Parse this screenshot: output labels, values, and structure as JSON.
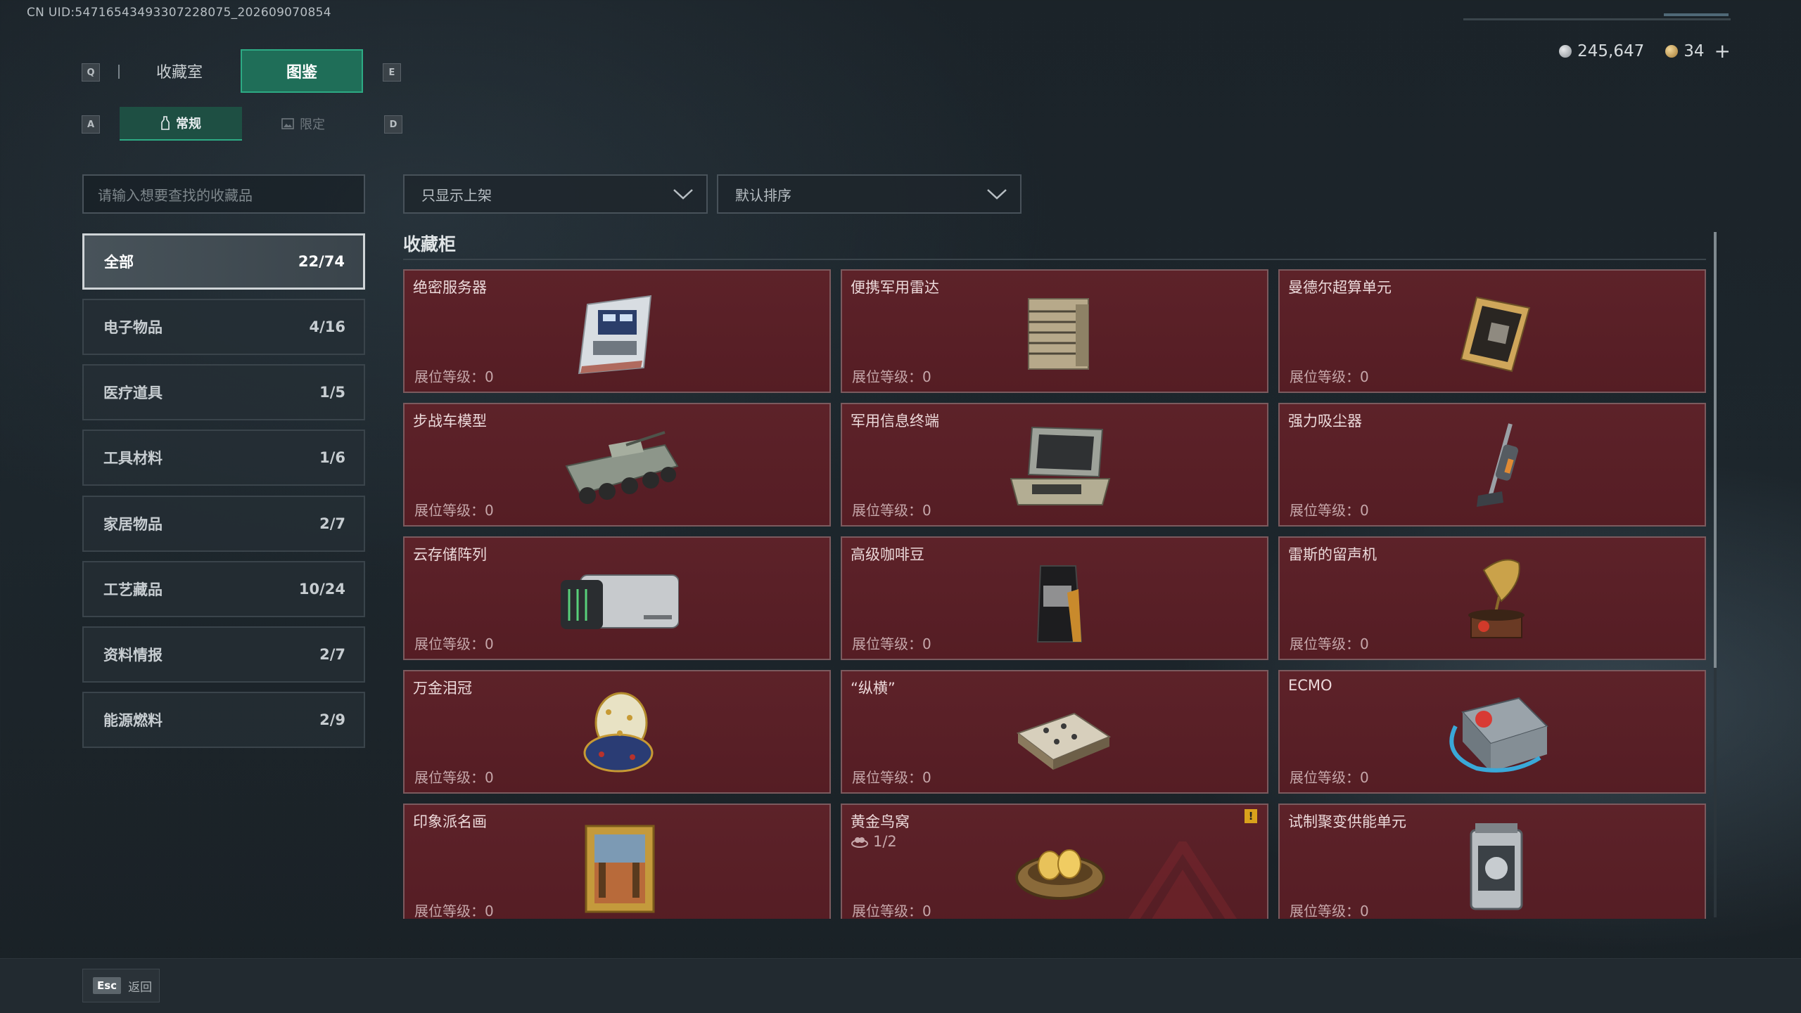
{
  "uid_text": "CN UID:5471654349330722807​5_202609070854",
  "currency": {
    "silver": "245,647",
    "gold": "34",
    "plus_icon": "+"
  },
  "keys": {
    "prev_tab": "Q",
    "next_tab": "E",
    "prev_sub": "A",
    "next_sub": "D"
  },
  "tabs": [
    {
      "label": "收藏室"
    },
    {
      "label": "图鉴"
    }
  ],
  "subtabs": [
    {
      "label": "常规"
    },
    {
      "label": "限定"
    }
  ],
  "search": {
    "placeholder": "请输入想要查找的收藏品"
  },
  "filters": {
    "show_label": "只显示上架",
    "sort_label": "默认排序"
  },
  "categories": [
    {
      "label": "全部",
      "count": "22/74"
    },
    {
      "label": "电子物品",
      "count": "4/16"
    },
    {
      "label": "医疗道具",
      "count": "1/5"
    },
    {
      "label": "工具材料",
      "count": "1/6"
    },
    {
      "label": "家居物品",
      "count": "2/7"
    },
    {
      "label": "工艺藏品",
      "count": "10/24"
    },
    {
      "label": "资料情报",
      "count": "2/7"
    },
    {
      "label": "能源燃料",
      "count": "2/9"
    }
  ],
  "section_title": "收藏柜",
  "items": [
    {
      "name": "绝密服务器",
      "level": "展位等级：0",
      "icon": "server-icon"
    },
    {
      "name": "便携军用雷达",
      "level": "展位等级：0",
      "icon": "radar-icon"
    },
    {
      "name": "曼德尔超算单元",
      "level": "展位等级：0",
      "icon": "compute-unit-icon"
    },
    {
      "name": "步战车模型",
      "level": "展位等级：0",
      "icon": "ifv-model-icon"
    },
    {
      "name": "军用信息终端",
      "level": "展位等级：0",
      "icon": "terminal-icon"
    },
    {
      "name": "强力吸尘器",
      "level": "展位等级：0",
      "icon": "vacuum-icon"
    },
    {
      "name": "云存储阵列",
      "level": "展位等级：0",
      "icon": "storage-array-icon"
    },
    {
      "name": "高级咖啡豆",
      "level": "展位等级：0",
      "icon": "coffee-bag-icon"
    },
    {
      "name": "雷斯的留声机",
      "level": "展位等级：0",
      "icon": "gramophone-icon"
    },
    {
      "name": "万金泪冠",
      "level": "展位等级：0",
      "icon": "jeweled-egg-icon"
    },
    {
      "name": "“纵横”",
      "level": "展位等级：0",
      "icon": "chess-board-icon"
    },
    {
      "name": "ECMO",
      "level": "展位等级：0",
      "icon": "ecmo-icon"
    },
    {
      "name": "印象派名画",
      "level": "展位等级：0",
      "icon": "painting-icon"
    },
    {
      "name": "黄金鸟窝",
      "level": "展位等级：0",
      "icon": "golden-nest-icon",
      "count": "1/2",
      "warn": "!"
    },
    {
      "name": "试制聚变供能单元",
      "level": "展位等级：0",
      "icon": "fusion-unit-icon"
    }
  ],
  "footer": {
    "esc_key": "Esc",
    "back_label": "返回"
  },
  "colors": {
    "accent": "#2dab84",
    "card_bg": "#5a2027",
    "card_border": "#7b5a5e"
  }
}
